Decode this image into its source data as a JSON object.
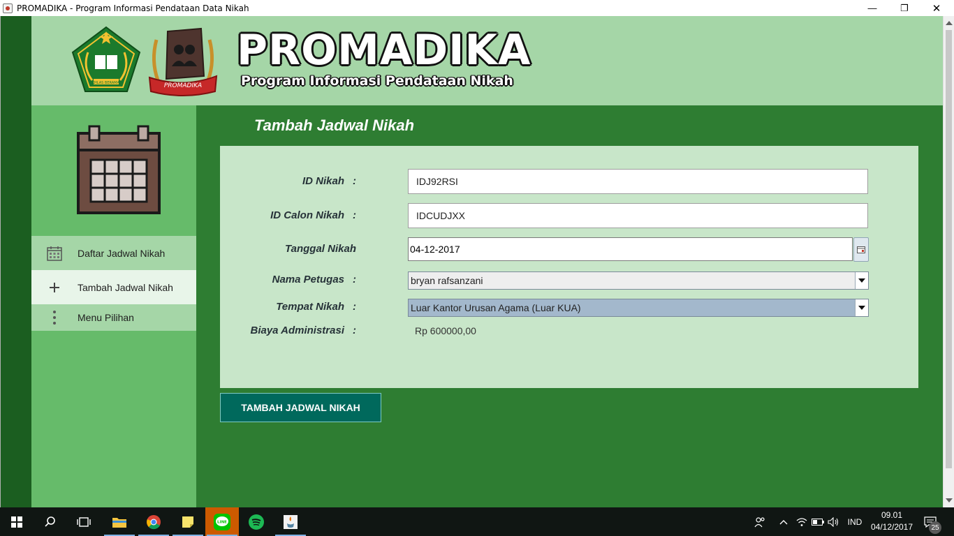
{
  "window": {
    "title": "PROMADIKA - Program Informasi Pendataan Data Nikah",
    "minimize": "—",
    "maximize": "❐",
    "close": "✕"
  },
  "header": {
    "brand_title": "PROMADIKA",
    "brand_subtitle": "Program Informasi Pendataan Nikah",
    "logo_left_text": "IKHLAS BERAMAL",
    "logo_right_text": "PROMADIKA"
  },
  "sidebar": {
    "items": [
      {
        "label": "Daftar Jadwal Nikah",
        "icon": "calendar-icon"
      },
      {
        "label": "Tambah Jadwal Nikah",
        "icon": "plus-icon"
      },
      {
        "label": "Menu Pilihan",
        "icon": "more-vertical-icon"
      }
    ]
  },
  "main": {
    "title": "Tambah Jadwal Nikah",
    "form": {
      "id_nikah_label": "ID Nikah",
      "id_nikah_value": "IDJ92RSI",
      "id_calon_label": "ID Calon Nikah",
      "id_calon_value": "IDCUDJXX",
      "tanggal_label": "Tanggal Nikah",
      "tanggal_value": "04-12-2017",
      "petugas_label": "Nama Petugas",
      "petugas_value": "bryan rafsanzani",
      "tempat_label": "Tempat Nikah",
      "tempat_value": "Luar Kantor Urusan Agama (Luar KUA)",
      "biaya_label": "Biaya Administrasi",
      "biaya_value": "Rp 600000,00",
      "colon": ":"
    },
    "submit_label": "TAMBAH JADWAL NIKAH"
  },
  "taskbar": {
    "language": "IND",
    "time": "09.01",
    "date": "04/12/2017",
    "notifications": "25",
    "line_label": "LINE"
  },
  "colors": {
    "header_bg": "#a5d6a7",
    "main_bg": "#2e7d32",
    "sidebar_bg": "#66bb6a",
    "panel_bg": "#c8e6c9",
    "button_bg": "#00695c"
  }
}
